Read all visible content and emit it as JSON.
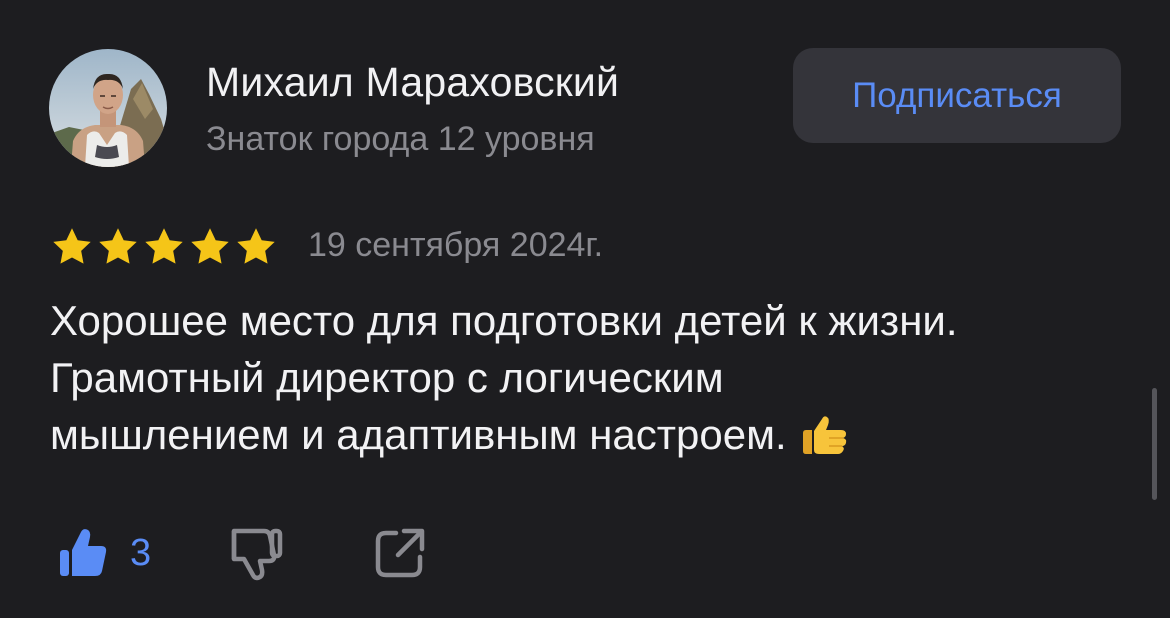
{
  "author": {
    "name": "Михаил Мараховский",
    "level": "Знаток города 12 уровня"
  },
  "subscribe": {
    "label": "Подписаться"
  },
  "review": {
    "rating": 5,
    "date": "19 сентября 2024г.",
    "lines": [
      "Хорошее место для подготовки детей к жизни.",
      "Грамотный директор с логическим",
      "мышлением и адаптивным настроем."
    ]
  },
  "actions": {
    "likes": "3"
  },
  "colors": {
    "background": "#1d1d20",
    "accent": "#5a8cf5",
    "star": "#f5c518",
    "muted": "#8a8a90",
    "button_bg": "#34343a"
  },
  "icons": [
    "thumbs-up-icon",
    "thumbs-down-icon",
    "share-icon",
    "thumbs-up-emoji-icon",
    "star-icon"
  ]
}
